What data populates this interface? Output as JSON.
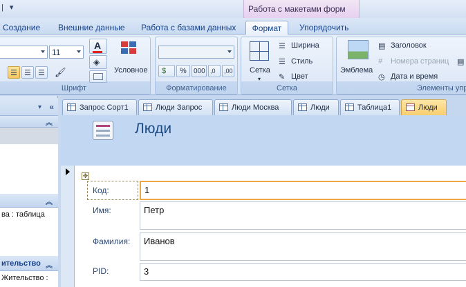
{
  "context_group": "Работа с макетами форм",
  "tabs": [
    "Создание",
    "Внешние данные",
    "Работа с базами данных",
    "Формат",
    "Упорядочить"
  ],
  "active_tab": "Формат",
  "ribbon": {
    "font": {
      "label": "Шрифт",
      "font_size": "11",
      "conditional": "Условное"
    },
    "formatting": {
      "label": "Форматирование",
      "percent": "%",
      "thousands": "000"
    },
    "grid": {
      "label": "Сетка",
      "grid_button": "Сетка",
      "width": "Ширина",
      "style": "Стиль",
      "color": "Цвет"
    },
    "controls": {
      "label": "Элементы упр",
      "logo": "Эмблема",
      "title": "Заголовок",
      "page_numbers": "Номера страниц",
      "date_time": "Дата и время"
    }
  },
  "nav": {
    "item_partial": "ва : таблица",
    "group_header": "ительство",
    "group_item": "Жительство :"
  },
  "doc_tabs": [
    {
      "label": "Запрос Сорт1",
      "kind": "query"
    },
    {
      "label": "Люди Запрос",
      "kind": "query"
    },
    {
      "label": "Люди Москва",
      "kind": "query"
    },
    {
      "label": "Люди",
      "kind": "table"
    },
    {
      "label": "Таблица1",
      "kind": "table"
    },
    {
      "label": "Люди",
      "kind": "form",
      "active": true
    }
  ],
  "form": {
    "title": "Люди",
    "fields": [
      {
        "label": "Код:",
        "value": "1"
      },
      {
        "label": "Имя:",
        "value": "Петр"
      },
      {
        "label": "Фамилия:",
        "value": "Иванов"
      },
      {
        "label": "PID:",
        "value": "3"
      }
    ]
  },
  "colors": {
    "ribbon_bg": "#d6e4f6",
    "active_tab": "#f7cd6f",
    "form_header": "#c2d7f2",
    "focus_border": "#f1a646"
  }
}
